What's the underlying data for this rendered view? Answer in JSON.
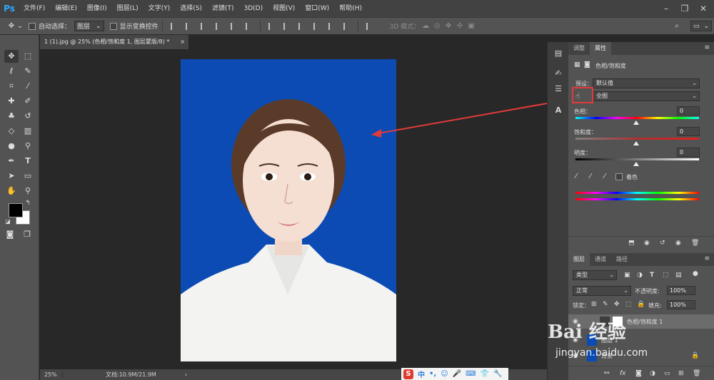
{
  "app": {
    "logo": "Ps",
    "menu": [
      "文件(F)",
      "编辑(E)",
      "图像(I)",
      "图层(L)",
      "文字(Y)",
      "选择(S)",
      "滤镜(T)",
      "3D(D)",
      "视图(V)",
      "窗口(W)",
      "帮助(H)"
    ]
  },
  "options": {
    "auto_select_label": "自动选择：",
    "auto_select_value": "图层",
    "show_transform_label": "显示变换控件",
    "mode_3d_label": "3D 模式："
  },
  "document": {
    "tab_title": "1 (1).jpg @ 25% (色相/饱和度 1, 图层蒙版/8) *",
    "zoom": "25%",
    "doc_info": "文档:10.9M/21.9M",
    "bg_color": "#0c4bb3"
  },
  "properties": {
    "tabs": [
      "调整",
      "属性"
    ],
    "title": "色相/饱和度",
    "preset_label": "预设：",
    "preset_value": "默认值",
    "channel_value": "全图",
    "hue_label": "色相：",
    "hue_value": "0",
    "saturation_label": "饱和度：",
    "saturation_value": "0",
    "lightness_label": "明度：",
    "lightness_value": "0",
    "colorize_label": "着色"
  },
  "layers": {
    "tabs": [
      "图层",
      "通道",
      "路径"
    ],
    "filter_kind": "类型",
    "blend_mode": "正常",
    "opacity_label": "不透明度:",
    "opacity_value": "100%",
    "lock_label": "锁定：",
    "fill_label": "填充:",
    "fill_value": "100%",
    "items": [
      "色相/饱和度 1",
      "图层 1",
      "背景"
    ]
  },
  "watermark": {
    "brand": "Bai 经验",
    "url": "jingyan.baidu.com"
  },
  "ime": {
    "logo": "S",
    "mode": "中"
  }
}
